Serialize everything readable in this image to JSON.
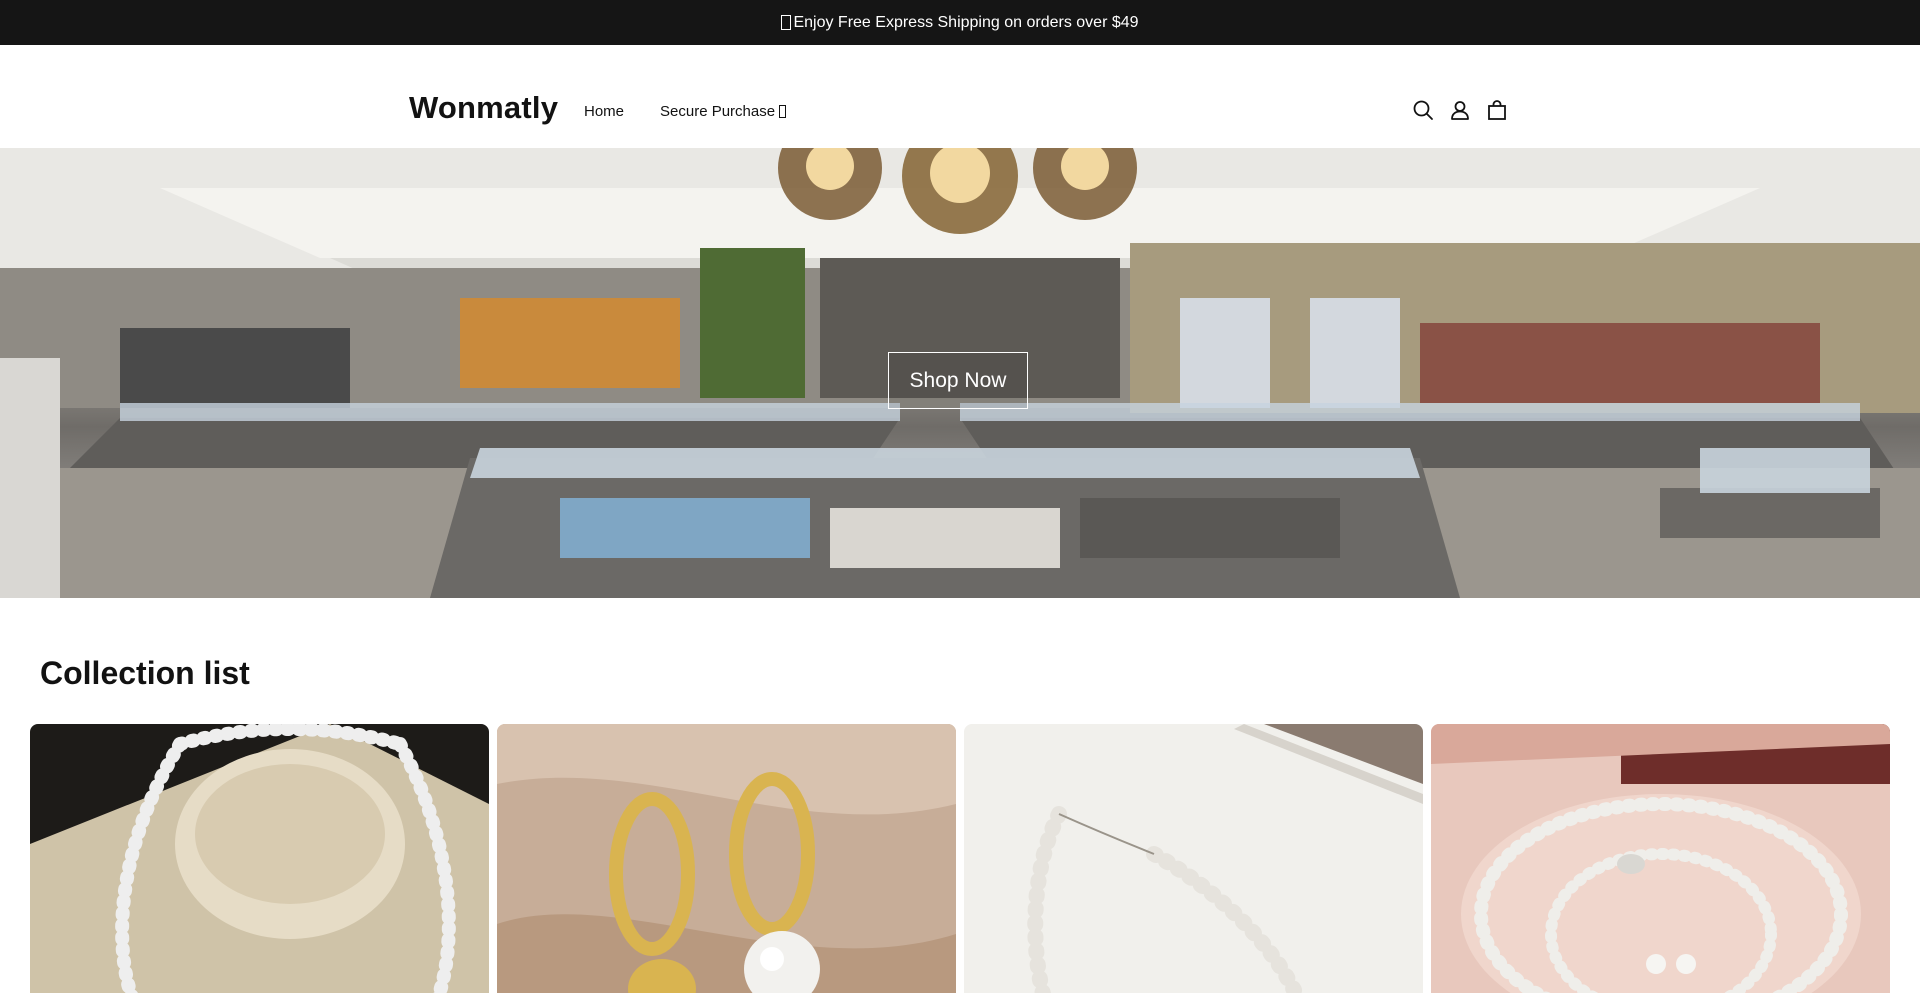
{
  "announcement": {
    "text": "Enjoy Free Express Shipping on orders over $49",
    "glyph_icon": "unknown-glyph-icon"
  },
  "header": {
    "logo": "Wonmatly",
    "nav": [
      {
        "label": "Home"
      },
      {
        "label": "Secure Purchase",
        "glyph_icon": "unknown-glyph-icon"
      }
    ],
    "icons": [
      "search-icon",
      "account-icon",
      "cart-icon"
    ]
  },
  "hero": {
    "button_label": "Shop Now",
    "image": "jewelry-store-interior"
  },
  "collection": {
    "title": "Collection list",
    "cards": [
      {
        "image": "pearl-necklace-on-stand"
      },
      {
        "image": "gold-pearl-earrings"
      },
      {
        "image": "pearl-bracelet"
      },
      {
        "image": "pearl-jewelry-set"
      }
    ]
  },
  "colors": {
    "announcement_bg": "#151515",
    "text": "#121212",
    "background": "#ffffff"
  }
}
